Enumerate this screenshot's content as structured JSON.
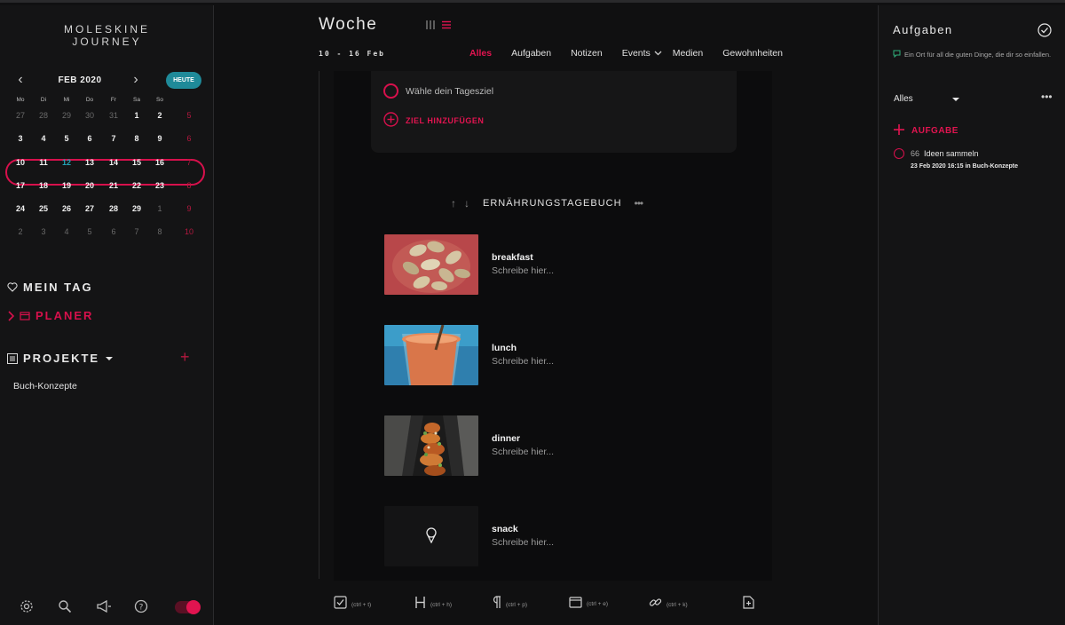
{
  "sidebar": {
    "logo_line1": "MOLESKINE",
    "logo_line2": "JOURNEY",
    "calendar": {
      "month": "FEB 2020",
      "today_button": "HEUTE",
      "weekdays": [
        "Mo",
        "Di",
        "Mi",
        "Do",
        "Fr",
        "Sa",
        "So"
      ],
      "weeks": [
        [
          "27",
          "28",
          "29",
          "30",
          "31",
          "1",
          "2"
        ],
        [
          "3",
          "4",
          "5",
          "6",
          "7",
          "8",
          "9"
        ],
        [
          "10",
          "11",
          "12",
          "13",
          "14",
          "15",
          "16"
        ],
        [
          "17",
          "18",
          "19",
          "20",
          "21",
          "22",
          "23"
        ],
        [
          "24",
          "25",
          "26",
          "27",
          "28",
          "29",
          "1"
        ],
        [
          "2",
          "3",
          "4",
          "5",
          "6",
          "7",
          "8"
        ]
      ],
      "week_numbers": [
        "5",
        "6",
        "7",
        "8",
        "9",
        "10"
      ]
    },
    "nav": {
      "mein_tag": "MEIN TAG",
      "planer": "PLANER",
      "projekte": "PROJEKTE"
    },
    "projects": [
      "Buch-Konzepte"
    ]
  },
  "main": {
    "title": "Woche",
    "date_range": "10 - 16 Feb",
    "tabs": [
      "Alles",
      "Aufgaben",
      "Notizen",
      "Events",
      "Medien",
      "Gewohnheiten"
    ],
    "goal_placeholder": "Wähle dein Tagesziel",
    "goal_add": "ZIEL HINZUFÜGEN",
    "section_title": "ERNÄHRUNGSTAGEBUCH",
    "meals": [
      {
        "name": "breakfast",
        "hint": "Schreibe hier..."
      },
      {
        "name": "lunch",
        "hint": "Schreibe hier..."
      },
      {
        "name": "dinner",
        "hint": "Schreibe hier..."
      },
      {
        "name": "snack",
        "hint": "Schreibe hier..."
      }
    ],
    "toolbar": [
      {
        "icon": "checkbox-icon",
        "hint": "(ctrl + t)"
      },
      {
        "icon": "heading-icon",
        "hint": "(ctrl + h)"
      },
      {
        "icon": "paragraph-icon",
        "hint": "(ctrl + p)"
      },
      {
        "icon": "calendar-icon",
        "hint": "(ctrl + e)"
      },
      {
        "icon": "link-icon",
        "hint": "(ctrl + k)"
      },
      {
        "icon": "add-page-icon",
        "hint": ""
      }
    ]
  },
  "right": {
    "title": "Aufgaben",
    "description": "Ein Ort für all die guten Dinge, die dir so einfallen.",
    "filter": "Alles",
    "add_label": "AUFGABE",
    "tasks": [
      {
        "count": "66",
        "name": "Ideen sammeln",
        "meta": "23 Feb 2020  16:15  in Buch-Konzepte"
      }
    ]
  },
  "colors": {
    "accent": "#e11450",
    "today": "#23a5b8",
    "background": "#101011"
  }
}
